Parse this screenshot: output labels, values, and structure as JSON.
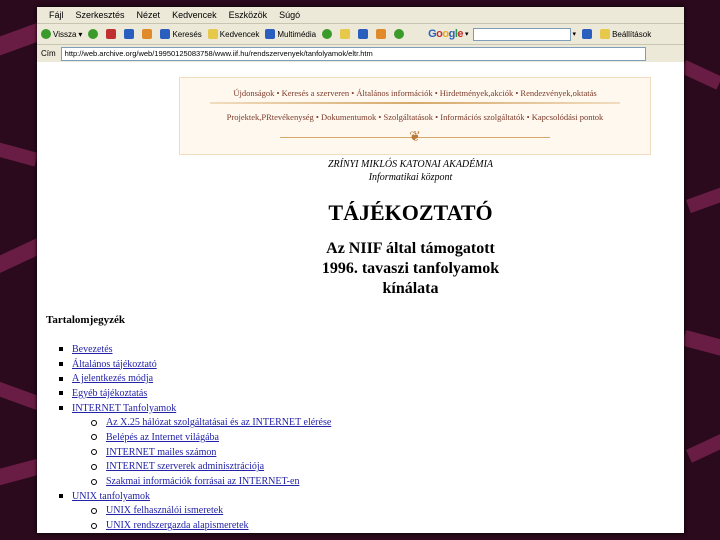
{
  "menu": [
    "Fájl",
    "Szerkesztés",
    "Nézet",
    "Kedvencek",
    "Eszközök",
    "Súgó"
  ],
  "toolbar": {
    "back": "Vissza",
    "search": "Keresés",
    "favorites": "Kedvencek",
    "media": "Multimédia",
    "google_menu": "Google",
    "settings": "Beállítások"
  },
  "address": {
    "label": "Cím",
    "url": "http://web.archive.org/web/19950125083758/www.iif.hu/rendszervenyek/tanfolyamok/eltr.htm"
  },
  "banner": {
    "line1": "Újdonságok • Keresés a szerveren • Általános információk • Hirdetmények,akciók • Rendezvények,oktatás",
    "line2": "Projektek,PRtevékenység • Dokumentumok • Szolgáltatások • Információs szolgáltatók • Kapcsolódási pontok"
  },
  "page": {
    "institution": "ZRÍNYI MIKLÓS KATONAI AKADÉMIA",
    "department": "Informatikai központ",
    "title": "TÁJÉKOZTATÓ",
    "subtitle1": "Az NIIF által támogatott",
    "subtitle2": "1996. tavaszi tanfolyamok",
    "subtitle3": "kínálata",
    "toc_title": "Tartalomjegyzék"
  },
  "toc": [
    {
      "label": "Bevezetés",
      "level": 1
    },
    {
      "label": "Általános tájékoztató",
      "level": 1
    },
    {
      "label": "A jelentkezés módja",
      "level": 1
    },
    {
      "label": "Egyéb tájékoztatás",
      "level": 1
    },
    {
      "label": "INTERNET Tanfolyamok",
      "level": 1
    },
    {
      "label": "Az X.25 hálózat szolgáltatásai és az INTERNET elérése",
      "level": 2
    },
    {
      "label": "Belépés az Internet világába",
      "level": 2
    },
    {
      "label": "INTERNET mailes számon",
      "level": 2
    },
    {
      "label": "INTERNET szerverek adminisztrációja",
      "level": 2
    },
    {
      "label": "Szakmai információk forrásai az INTERNET-en",
      "level": 2
    },
    {
      "label": "UNIX tanfolyamok",
      "level": 1
    },
    {
      "label": "UNIX felhasználói ismeretek",
      "level": 2
    },
    {
      "label": "UNIX rendszergazda alapismeretek",
      "level": 2
    }
  ],
  "colors": {
    "link": "#2323a8",
    "banner_text": "#7a3a2a",
    "background": "#2a0a1c"
  }
}
